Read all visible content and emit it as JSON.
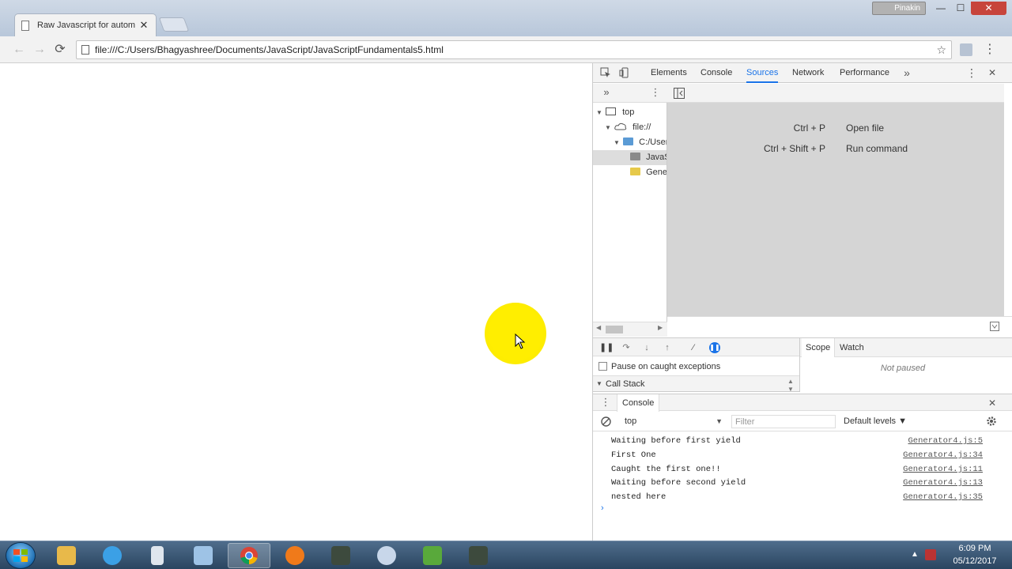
{
  "window": {
    "profile_name": "Pinakin",
    "min_glyph": "—",
    "max_glyph": "☐",
    "close_glyph": "✕"
  },
  "tab": {
    "title": "Raw Javascript for autom",
    "close_glyph": "✕"
  },
  "toolbar": {
    "back_glyph": "←",
    "forward_glyph": "→",
    "reload_glyph": "⟳",
    "url": "file:///C:/Users/Bhagyashree/Documents/JavaScript/JavaScriptFundamentals5.html",
    "star_glyph": "☆",
    "menu_glyph": "⋮"
  },
  "devtools": {
    "tabs": [
      "Elements",
      "Console",
      "Sources",
      "Network",
      "Performance"
    ],
    "active_tab": "Sources",
    "more_tabs_glyph": "»",
    "menu_glyph": "⋮",
    "close_glyph": "✕",
    "navigator": {
      "more_glyph": "»",
      "menu_glyph": "⋮",
      "tree": [
        {
          "label": "top",
          "indent": 0,
          "icon": "frame-icon",
          "expanded": true
        },
        {
          "label": "file://",
          "indent": 1,
          "icon": "cloud-icon",
          "expanded": true
        },
        {
          "label": "C:/User",
          "indent": 2,
          "icon": "folder-icon-blue",
          "expanded": true
        },
        {
          "label": "JavaS",
          "indent": 3,
          "icon": "folder-icon-gray",
          "expanded": false,
          "selected": true
        },
        {
          "label": "Gene",
          "indent": 3,
          "icon": "folder-icon-yellow",
          "expanded": false
        }
      ]
    },
    "editor": {
      "shortcuts": [
        {
          "key": "Ctrl + P",
          "label": "Open file"
        },
        {
          "key": "Ctrl + Shift + P",
          "label": "Run command"
        }
      ]
    },
    "debugger": {
      "pause_on_caught_label": "Pause on caught exceptions",
      "pause_on_caught_checked": false,
      "call_stack_label": "Call Stack",
      "scope_tab": "Scope",
      "watch_tab": "Watch",
      "not_paused": "Not paused"
    },
    "drawer": {
      "tab_label": "Console",
      "menu_glyph": "⋮",
      "close_glyph": "✕",
      "context": "top",
      "filter_placeholder": "Filter",
      "levels_label": "Default levels ▼",
      "messages": [
        {
          "text": "Waiting before first yield",
          "source": "Generator4.js:5"
        },
        {
          "text": "First One",
          "source": "Generator4.js:34"
        },
        {
          "text": "Caught the first one!!",
          "source": "Generator4.js:11"
        },
        {
          "text": "Waiting before second yield",
          "source": "Generator4.js:13"
        },
        {
          "text": "nested here",
          "source": "Generator4.js:35"
        }
      ],
      "prompt_glyph": "›"
    }
  },
  "taskbar": {
    "items": [
      {
        "name": "explorer",
        "color": "#e8b94a"
      },
      {
        "name": "internet-explorer",
        "color": "#3ba0e6"
      },
      {
        "name": "app-3",
        "color": "#dfe6ee"
      },
      {
        "name": "app-4",
        "color": "#9ec3e6"
      },
      {
        "name": "chrome",
        "color": "#e4483a",
        "active": true
      },
      {
        "name": "firefox",
        "color": "#f07a1a"
      },
      {
        "name": "app-7",
        "color": "#3d4a3d"
      },
      {
        "name": "paint",
        "color": "#c8d7ea"
      },
      {
        "name": "app-9",
        "color": "#59a93b"
      },
      {
        "name": "app-10",
        "color": "#3d4a3d"
      }
    ],
    "time": "6:09 PM",
    "date": "05/12/2017",
    "tray_arrow": "▲"
  },
  "colors": {
    "accent": "#1a73e8",
    "cursor_highlight": "#ffee00",
    "editor_placeholder_bg": "#d5d5d5"
  }
}
